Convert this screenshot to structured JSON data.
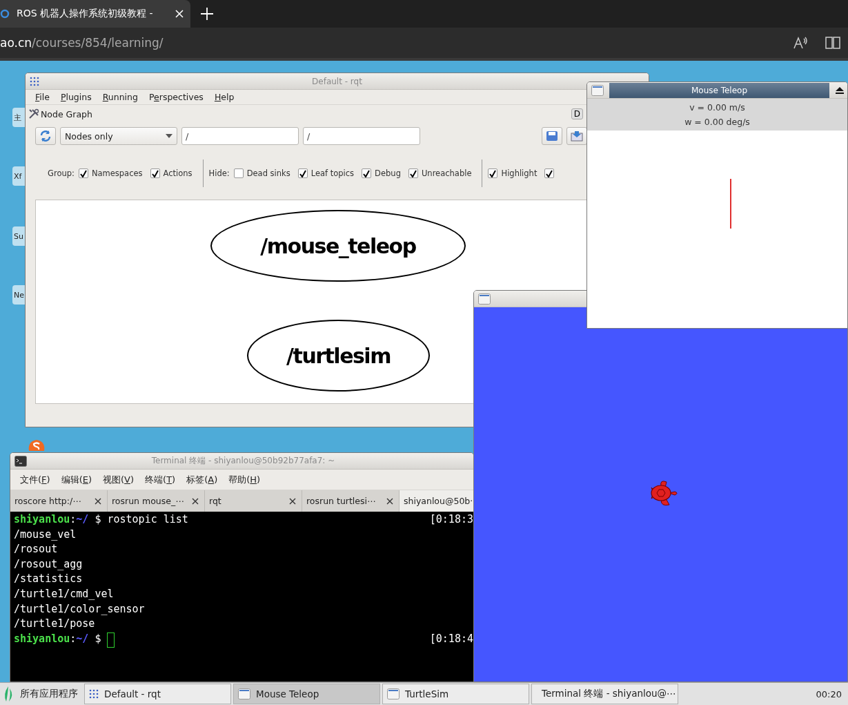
{
  "browser": {
    "tab": {
      "title": "ROS 机器人操作系统初级教程 -"
    },
    "url_host": "ao.cn",
    "url_path": "/courses/854/learning/"
  },
  "desktop_icons": [
    {
      "label": "主"
    },
    {
      "label": "Xf"
    },
    {
      "label": "Su"
    },
    {
      "label": "Ne"
    }
  ],
  "rqt": {
    "title": "Default - rqt",
    "menu": [
      {
        "key": "F",
        "after": "ile"
      },
      {
        "key": "P",
        "after": "lugins"
      },
      {
        "key": "R",
        "after": "unning"
      },
      {
        "before": "P",
        "key": "e",
        "after": "rspectives"
      },
      {
        "key": "H",
        "after": "elp"
      }
    ],
    "plugin": {
      "title": "Node Graph",
      "badge": "D"
    },
    "toolbar": {
      "mode": "Nodes only",
      "filters": [
        {
          "value": "/"
        },
        {
          "value": "/"
        }
      ]
    },
    "option_groups": [
      {
        "label": "Group:",
        "options": [
          {
            "label": "Namespaces",
            "checked": true
          },
          {
            "label": "Actions",
            "checked": true
          }
        ]
      },
      {
        "label": "Hide:",
        "options": [
          {
            "label": "Dead sinks",
            "checked": false
          },
          {
            "label": "Leaf topics",
            "checked": true
          },
          {
            "label": "Debug",
            "checked": true
          },
          {
            "label": "Unreachable",
            "checked": true
          }
        ]
      },
      {
        "options": [
          {
            "label": "Highlight",
            "checked": true
          },
          {
            "checked": true
          }
        ]
      }
    ],
    "nodes": [
      {
        "label": "/mouse_teleop"
      },
      {
        "label": "/turtlesim"
      }
    ]
  },
  "terminal": {
    "title": "Terminal 终端 - shiyanlou@50b92b77afa7: ~",
    "menu": [
      {
        "before": "文件(",
        "key": "F",
        "after": ")"
      },
      {
        "before": "编辑(",
        "key": "E",
        "after": ")"
      },
      {
        "before": "视图(",
        "key": "V",
        "after": ")"
      },
      {
        "before": "终端(",
        "key": "T",
        "after": ")"
      },
      {
        "before": "标签(",
        "key": "A",
        "after": ")"
      },
      {
        "before": "帮助(",
        "key": "H",
        "after": ")"
      }
    ],
    "tabs": [
      {
        "label": "roscore http:/⋯",
        "selected": false
      },
      {
        "label": "rosrun mouse_⋯",
        "selected": false
      },
      {
        "label": "rqt",
        "selected": false
      },
      {
        "label": "rosrun turtlesi⋯",
        "selected": false
      },
      {
        "label": "shiyanlou@50b·",
        "selected": true
      }
    ],
    "lines": [
      {
        "kind": "prompt",
        "user": "shiyanlou",
        "sep": ":",
        "path": "~/",
        "sign": "$",
        "command": "rostopic list",
        "time": "[0:18:3"
      },
      {
        "kind": "output",
        "text": "/mouse_vel"
      },
      {
        "kind": "output",
        "text": "/rosout"
      },
      {
        "kind": "output",
        "text": "/rosout_agg"
      },
      {
        "kind": "output",
        "text": "/statistics"
      },
      {
        "kind": "output",
        "text": "/turtle1/cmd_vel"
      },
      {
        "kind": "output",
        "text": "/turtle1/color_sensor"
      },
      {
        "kind": "output",
        "text": "/turtle1/pose"
      },
      {
        "kind": "prompt",
        "user": "shiyanlou",
        "sep": ":",
        "path": "~/",
        "sign": "$",
        "cursor": true,
        "time": "[0:18:4"
      }
    ]
  },
  "mouse_teleop": {
    "title": "Mouse Teleop",
    "readouts": [
      "v = 0.00 m/s",
      "w = 0.00 deg/s"
    ]
  },
  "taskbar": {
    "start": "所有应用程序",
    "items": [
      {
        "label": "Default - rqt",
        "kind": "grid",
        "selected": false
      },
      {
        "label": "Mouse Teleop",
        "kind": "window",
        "selected": true
      },
      {
        "label": "TurtleSim",
        "kind": "window",
        "selected": false
      },
      {
        "label": "Terminal 终端 - shiyanlou@⋯",
        "kind": "terminal",
        "selected": false
      }
    ],
    "clock": "00:20"
  }
}
